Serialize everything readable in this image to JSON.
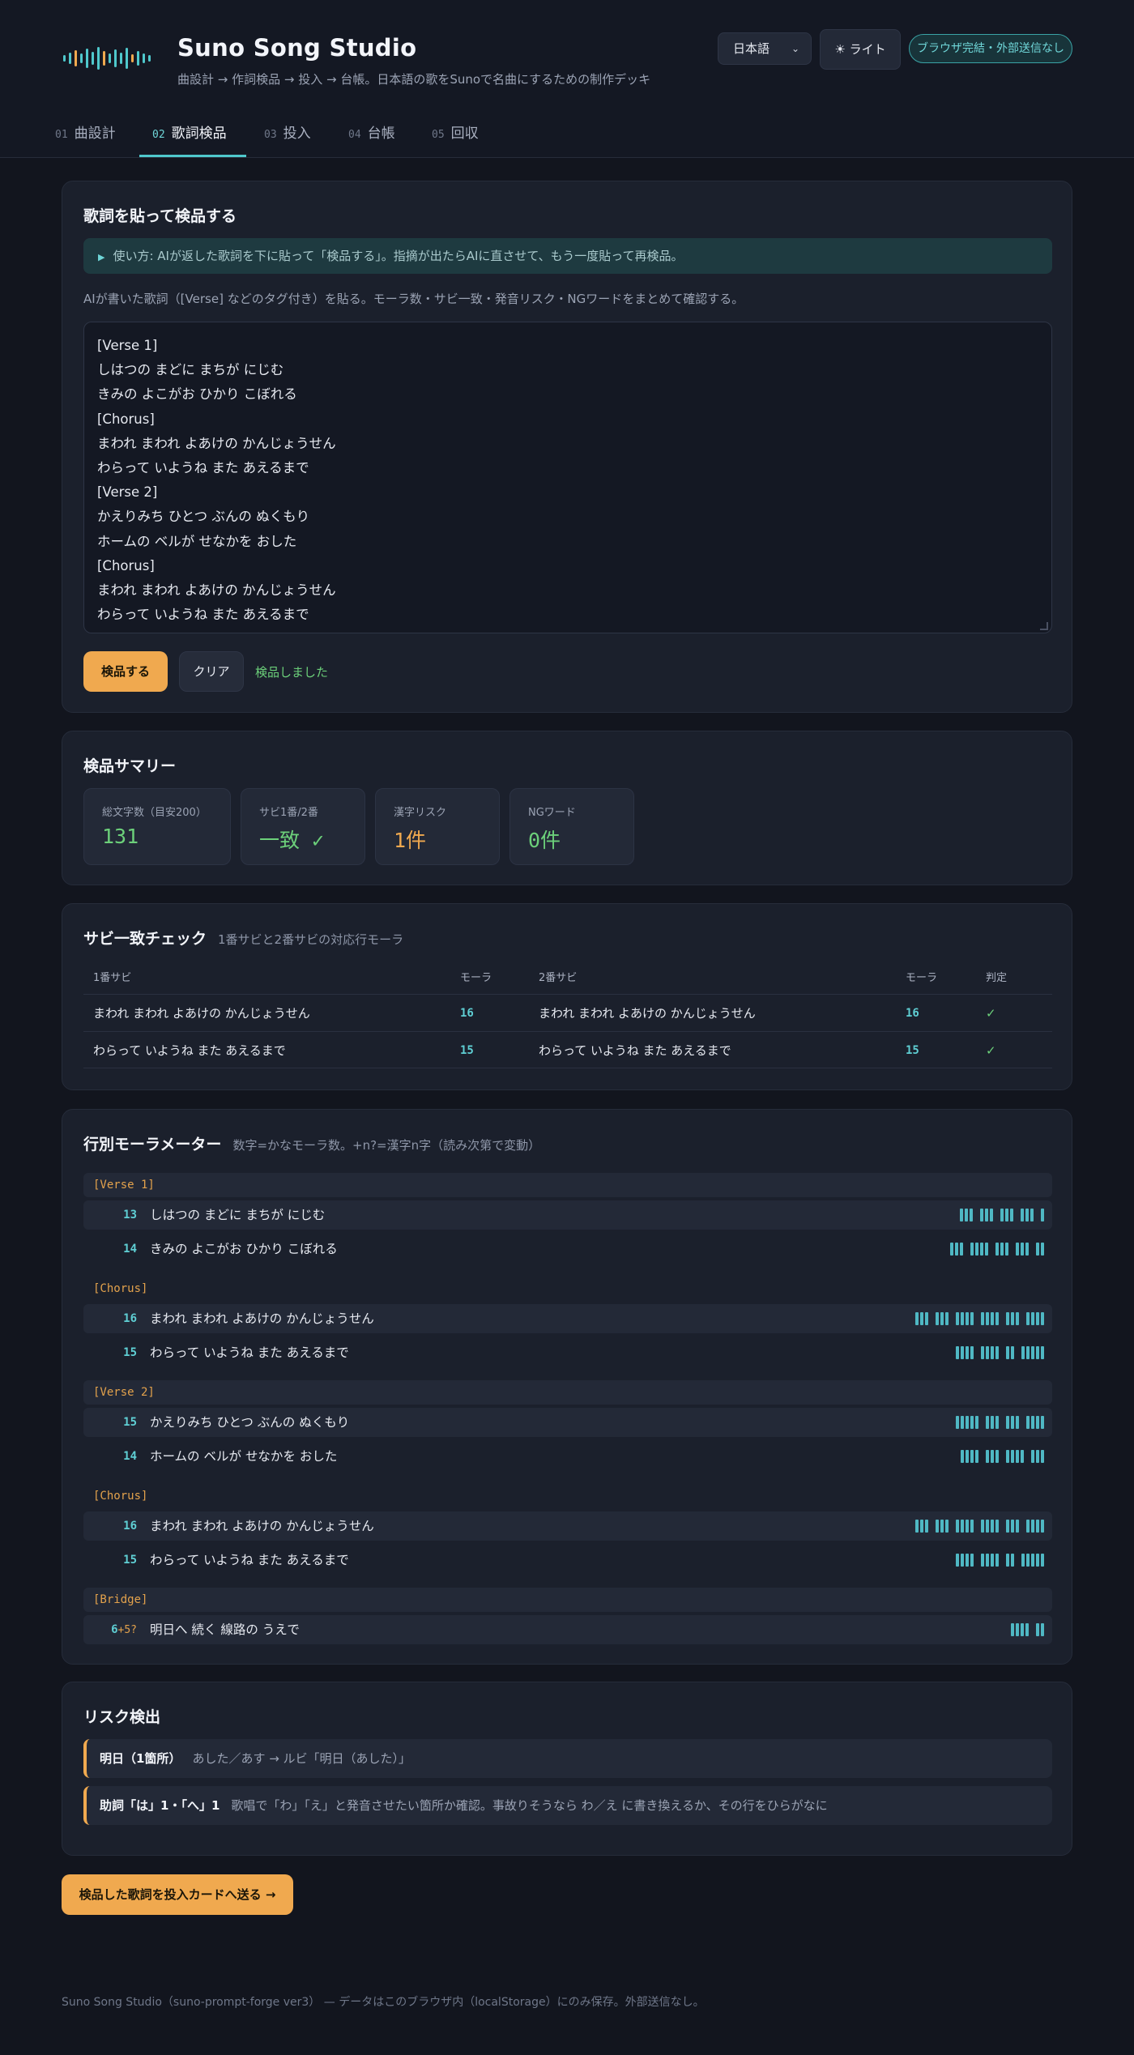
{
  "header": {
    "title": "Suno Song Studio",
    "subtitle": "曲設計 → 作詞検品 → 投入 → 台帳。日本語の歌をSunoで名曲にするための制作デッキ",
    "language": "日本語",
    "theme_label": "☀ ライト",
    "badge": "ブラウザ完結・外部送信なし"
  },
  "tabs": [
    {
      "num": "01",
      "label": "曲設計"
    },
    {
      "num": "02",
      "label": "歌詞検品"
    },
    {
      "num": "03",
      "label": "投入"
    },
    {
      "num": "04",
      "label": "台帳"
    },
    {
      "num": "05",
      "label": "回収"
    }
  ],
  "active_tab": "02",
  "paste": {
    "title": "歌詞を貼って検品する",
    "hint": "使い方: AIが返した歌詞を下に貼って「検品する」。指摘が出たらAIに直させて、もう一度貼って再検品。",
    "description": "AIが書いた歌詞（[Verse] などのタグ付き）を貼る。モーラ数・サビ一致・発音リスク・NGワードをまとめて確認する。",
    "lyrics": [
      "[Verse 1]",
      "しはつの まどに まちが にじむ",
      "きみの よこがお ひかり こぼれる",
      "[Chorus]",
      "まわれ まわれ よあけの かんじょうせん",
      "わらって いようね また あえるまで",
      "[Verse 2]",
      "かえりみち ひとつ ぶんの ぬくもり",
      "ホームの ベルが せなかを おした",
      "[Chorus]",
      "まわれ まわれ よあけの かんじょうせん",
      "わらって いようね また あえるまで",
      "[Bridge]"
    ],
    "check_button": "検品する",
    "clear_button": "クリア",
    "status": "検品しました"
  },
  "summary": {
    "title": "検品サマリー",
    "stats": [
      {
        "label": "総文字数（目安200）",
        "value": "131",
        "color": "#6cd07a"
      },
      {
        "label": "サビ1番/2番",
        "value": "一致 ✓",
        "color": "#6cd07a"
      },
      {
        "label": "漢字リスク",
        "value": "1件",
        "color": "#f0a94f"
      },
      {
        "label": "NGワード",
        "value": "0件",
        "color": "#6cd07a"
      }
    ]
  },
  "chorus_check": {
    "title": "サビ一致チェック",
    "subtitle": "1番サビと2番サビの対応行モーラ",
    "headers": {
      "chorus1": "1番サビ",
      "mora1": "モーラ",
      "chorus2": "2番サビ",
      "mora2": "モーラ",
      "verdict": "判定"
    },
    "rows": [
      {
        "chorus1": "まわれ まわれ よあけの かんじょうせん",
        "mora1": "16",
        "chorus2": "まわれ まわれ よあけの かんじょうせん",
        "mora2": "16",
        "verdict": "✓"
      },
      {
        "chorus1": "わらって いようね また あえるまで",
        "mora1": "15",
        "chorus2": "わらって いようね また あえるまで",
        "mora2": "15",
        "verdict": "✓"
      }
    ]
  },
  "mora_meter": {
    "title": "行別モーラメーター",
    "subtitle": "数字=かなモーラ数。+n?=漢字n字（読み次第で変動）",
    "sections": [
      {
        "label": "[Verse 1]",
        "lines": [
          {
            "count": "13",
            "extra": "",
            "text": "しはつの まどに まちが にじむ",
            "groups": [
              3,
              3,
              3,
              3,
              1
            ]
          },
          {
            "count": "14",
            "extra": "",
            "text": "きみの よこがお ひかり こぼれる",
            "groups": [
              3,
              4,
              3,
              3,
              2
            ]
          }
        ]
      },
      {
        "label": "[Chorus]",
        "lines": [
          {
            "count": "16",
            "extra": "",
            "text": "まわれ まわれ よあけの かんじょうせん",
            "groups": [
              3,
              3,
              4,
              4,
              3,
              4
            ]
          },
          {
            "count": "15",
            "extra": "",
            "text": "わらって いようね また あえるまで",
            "groups": [
              4,
              4,
              2,
              5,
              0
            ]
          }
        ]
      },
      {
        "label": "[Verse 2]",
        "lines": [
          {
            "count": "15",
            "extra": "",
            "text": "かえりみち ひとつ ぶんの ぬくもり",
            "groups": [
              5,
              3,
              3,
              4,
              0
            ]
          },
          {
            "count": "14",
            "extra": "",
            "text": "ホームの ベルが せなかを おした",
            "groups": [
              4,
              3,
              4,
              3,
              0
            ]
          }
        ]
      },
      {
        "label": "[Chorus]",
        "lines": [
          {
            "count": "16",
            "extra": "",
            "text": "まわれ まわれ よあけの かんじょうせん",
            "groups": [
              3,
              3,
              4,
              4,
              3,
              4
            ]
          },
          {
            "count": "15",
            "extra": "",
            "text": "わらって いようね また あえるまで",
            "groups": [
              4,
              4,
              2,
              5,
              0
            ]
          }
        ]
      },
      {
        "label": "[Bridge]",
        "lines": [
          {
            "count": "6",
            "extra": "+5?",
            "text": "明日へ 続く 線路の うえで",
            "groups": [
              4,
              2
            ]
          }
        ]
      }
    ]
  },
  "risk": {
    "title": "リスク検出",
    "items": [
      {
        "title": "明日（1箇所）",
        "desc": "あした／あす → ルビ「明日（あした）」"
      },
      {
        "title": "助詞「は」1・「へ」1",
        "desc": "歌唱で「わ」「え」と発音させたい箇所か確認。事故りそうなら わ／え に書き換えるか、その行をひらがなに"
      }
    ]
  },
  "send_button": "検品した歌詞を投入カードへ送る →",
  "footer": "Suno Song Studio（suno-prompt-forge ver3） — データはこのブラウザ内（localStorage）にのみ保存。外部送信なし。",
  "colors": {
    "accent": "#f0a94f",
    "teal": "#4fc8cc",
    "ok": "#6cd07a",
    "bg": "#12151e"
  }
}
